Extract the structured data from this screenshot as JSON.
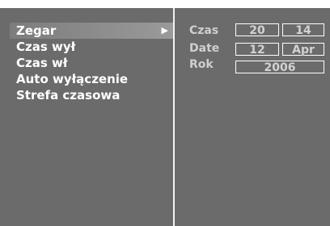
{
  "menu": {
    "items": [
      {
        "label": "Zegar",
        "selected": true,
        "arrow": "▶"
      },
      {
        "label": "Czas wył"
      },
      {
        "label": "Czas wł"
      },
      {
        "label": "Auto wyłączenie"
      },
      {
        "label": "Strefa czasowa"
      }
    ]
  },
  "clock": {
    "time_label": "Czas",
    "hour": "20",
    "minute": "14",
    "date_label": "Date",
    "day": "12",
    "month": "Apr",
    "year_label": "Rok",
    "year": "2006"
  },
  "colors": {
    "background": "#6b6b6b",
    "text": "#ffffff",
    "label": "#cfcfcf",
    "border": "#ffffff"
  },
  "icons": {
    "selected_arrow": "triangle-right-icon"
  }
}
